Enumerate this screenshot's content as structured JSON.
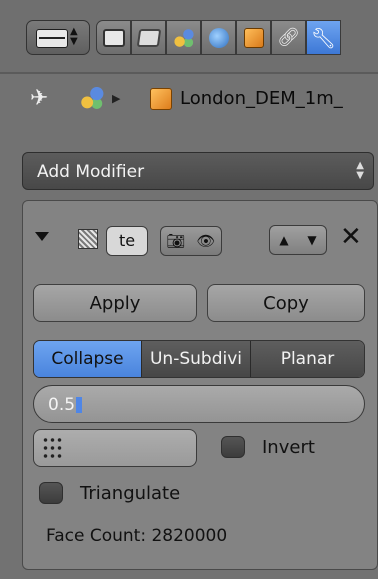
{
  "header": {
    "context_tabs": [
      "render-icon",
      "render-layers-icon",
      "scene-icon",
      "world-icon",
      "object-icon",
      "constraints-icon",
      "modifier-wrench-icon"
    ]
  },
  "breadcrumb": {
    "object_name": "London_DEM_1m_"
  },
  "add_modifier": {
    "label": "Add Modifier"
  },
  "modifier": {
    "name_value": "te",
    "apply_label": "Apply",
    "copy_label": "Copy",
    "modes": [
      "Collapse",
      "Un-Subdivi",
      "Planar"
    ],
    "active_mode": "Collapse",
    "ratio_value": "0.5",
    "invert_label": "Invert",
    "triangulate_label": "Triangulate",
    "face_count": "Face Count: 2820000"
  },
  "colors": {
    "accent": "#4a84dd",
    "panel": "#838383",
    "background": "#727272"
  }
}
